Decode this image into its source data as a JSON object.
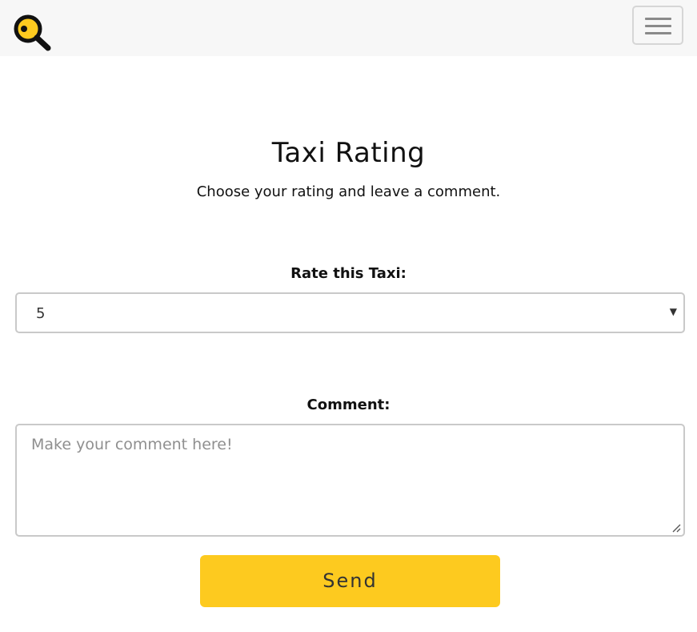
{
  "colors": {
    "navbar_background": "#f7f7f7",
    "accent": "#fdca1f",
    "border": "#c9c9c9",
    "placeholder": "#8f8f8f"
  },
  "navbar": {
    "logo_icon": "magnifier-logo-icon",
    "menu_icon": "hamburger-menu-icon"
  },
  "main": {
    "title": "Taxi Rating",
    "subtitle": "Choose your rating and leave a comment."
  },
  "rating": {
    "label": "Rate this Taxi:",
    "selected_value": "5",
    "caret_icon": "caret-down-icon"
  },
  "comment": {
    "label": "Comment:",
    "placeholder": "Make your comment here!",
    "value": ""
  },
  "send_button": {
    "label": "Send"
  }
}
